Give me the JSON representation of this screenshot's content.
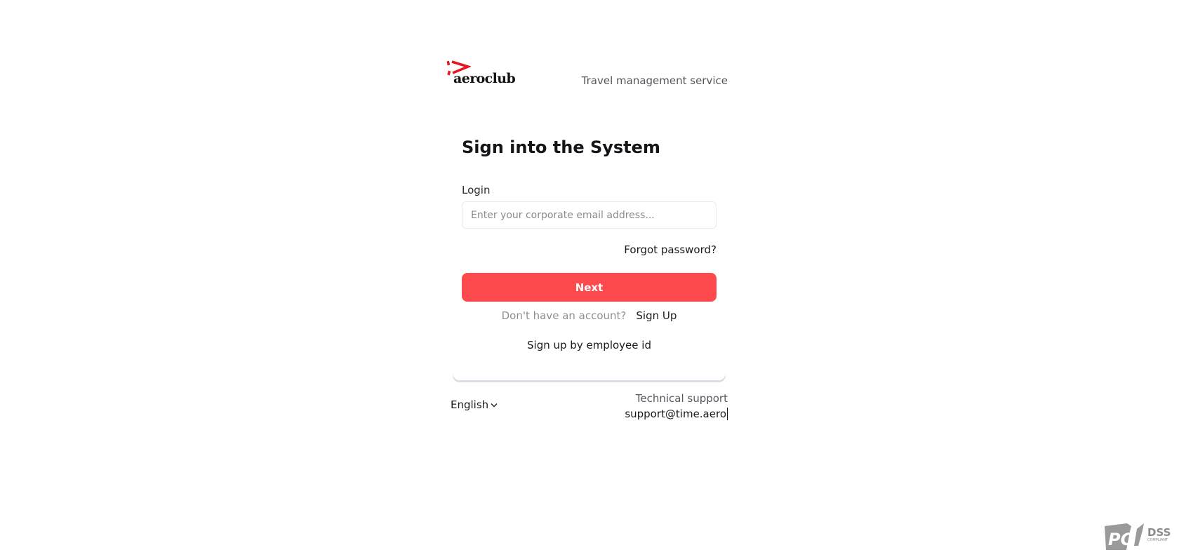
{
  "brand": {
    "name": "aeroclub",
    "tagline": "Travel management service",
    "accent": "#e8161e"
  },
  "login_form": {
    "title": "Sign into the System",
    "login_label": "Login",
    "login_placeholder": "Enter your corporate email address...",
    "login_value": "",
    "forgot_password": "Forgot password?",
    "next_label": "Next",
    "next_color": "#ff4a4d",
    "no_account_text": "Don't have an account?",
    "sign_up_label": "Sign Up",
    "employee_id_label": "Sign up by employee id"
  },
  "footer": {
    "language": "English",
    "language_icon": "chevron-down-icon",
    "support_title": "Technical support",
    "support_email": "support@time.aero"
  },
  "badge": {
    "logo_text": "PCI DSS COMPLIANT"
  }
}
